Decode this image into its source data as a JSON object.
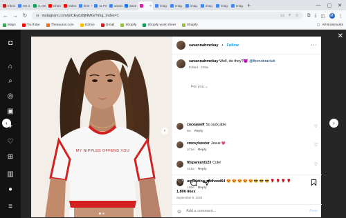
{
  "tabs": [
    {
      "label": "Inbox",
      "color": "#c5221f"
    },
    {
      "label": "GE 2",
      "color": "#4285f4"
    },
    {
      "label": "3, CE",
      "color": "#0f9d58"
    },
    {
      "label": "Chan",
      "color": "#ff0000"
    },
    {
      "label": "Video",
      "color": "#ff0000"
    },
    {
      "label": "time",
      "color": "#4285f4"
    },
    {
      "label": "11 Pe",
      "color": "#4285f4"
    },
    {
      "label": "savan",
      "color": "#4285f4"
    },
    {
      "label": "Save",
      "color": "#1a73e8"
    },
    {
      "label": "",
      "color": "#d6249f",
      "active": true
    },
    {
      "label": "imag",
      "color": "#4285f4"
    },
    {
      "label": "imag",
      "color": "#4285f4"
    },
    {
      "label": "imag",
      "color": "#4285f4"
    },
    {
      "label": "imag",
      "color": "#4285f4"
    },
    {
      "label": "imag",
      "color": "#4285f4"
    },
    {
      "label": "imag",
      "color": "#4285f4"
    }
  ],
  "address": {
    "url": "instagram.com/p/CEydz8jNMG/?img_index=1",
    "profile_initial": "M"
  },
  "bookmarks": {
    "items": [
      {
        "label": "Maps",
        "color": "#34a853"
      },
      {
        "label": "YouTube",
        "color": "#ff0000"
      },
      {
        "label": "Thesaurus.com",
        "color": "#f26b21"
      },
      {
        "label": "Gdrive",
        "color": "#fbbc04"
      },
      {
        "label": "Gmail",
        "color": "#c5221f"
      },
      {
        "label": "Shopify",
        "color": "#95bf47"
      },
      {
        "label": "Shopify work sheet",
        "color": "#0f9d58"
      },
      {
        "label": "Shopify",
        "color": "#95bf47"
      }
    ],
    "all_label": "All Bookmarks"
  },
  "post": {
    "username": "savannahmckay",
    "follow": "Follow",
    "caption_user": "savannahmckay",
    "caption_text": "Well, do they?😈",
    "caption_mention": "@thenobraclub",
    "caption_meta": "Edited · 248w",
    "for_you": "For you",
    "shirt_text": "MY NIPPLES OFFEND YOU",
    "likes": "1,806 likes",
    "date": "September 6, 2020",
    "add_comment_placeholder": "Add a comment...",
    "post_label": "Post"
  },
  "comments": [
    {
      "user": "cocoawolf",
      "text": "So suck able",
      "age": "8w",
      "reply": "Reply"
    },
    {
      "user": "cmcsylvester",
      "text": "Jesus 💗",
      "age": "101w",
      "reply": "Reply"
    },
    {
      "user": "fitspaniard123",
      "text": "Cute!",
      "age": "164w",
      "reply": "Reply"
    },
    {
      "user": "unyielding_redhood64",
      "text": "😍 😍 😍 😍 😍 😎 😎 😎 🌹 🌹 🌹 🌹",
      "age": "186w",
      "reply": "Reply"
    }
  ]
}
